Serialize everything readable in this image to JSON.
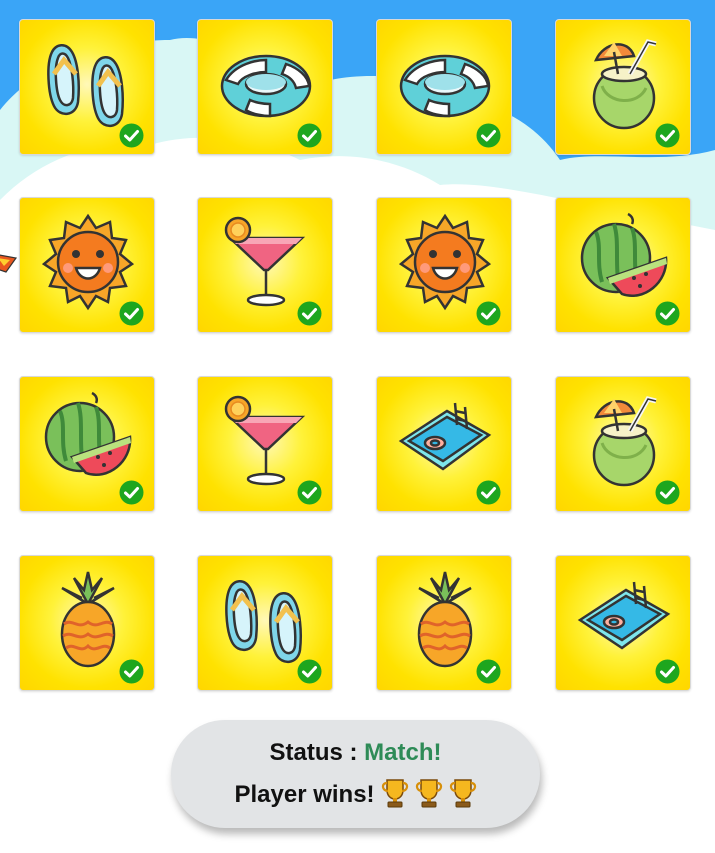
{
  "status": {
    "label": "Status :",
    "value": "Match!"
  },
  "result": {
    "text": "Player wins!",
    "trophies": 3
  },
  "grid": {
    "rows": 4,
    "cols": 4,
    "cards": [
      {
        "item": "flip-flops",
        "matched": true
      },
      {
        "item": "swim-ring",
        "matched": true
      },
      {
        "item": "swim-ring",
        "matched": true
      },
      {
        "item": "coconut-drink",
        "matched": true
      },
      {
        "item": "sun",
        "matched": true
      },
      {
        "item": "cocktail",
        "matched": true
      },
      {
        "item": "sun",
        "matched": true
      },
      {
        "item": "watermelon",
        "matched": true
      },
      {
        "item": "watermelon",
        "matched": true
      },
      {
        "item": "cocktail",
        "matched": true
      },
      {
        "item": "pool",
        "matched": true
      },
      {
        "item": "coconut-drink",
        "matched": true
      },
      {
        "item": "pineapple",
        "matched": true
      },
      {
        "item": "flip-flops",
        "matched": true
      },
      {
        "item": "pineapple",
        "matched": true
      },
      {
        "item": "pool",
        "matched": true
      }
    ]
  },
  "colors": {
    "sky": "#3aa5f7",
    "cloud_light": "#d9f7f5",
    "card_yellow": "#ffe600",
    "check_green": "#1ea61e",
    "status_green": "#2e8b57",
    "pill_bg": "#e2e4e6"
  }
}
